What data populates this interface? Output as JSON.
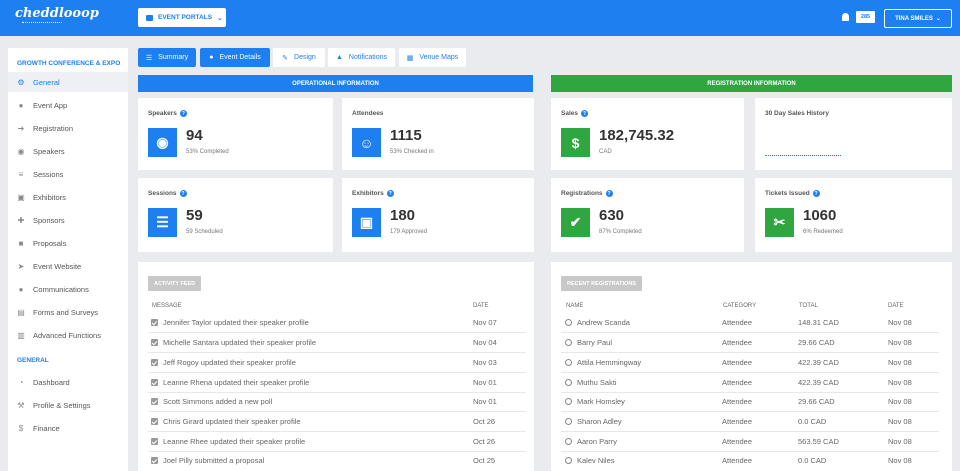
{
  "header": {
    "logo_text": "cheddlooop",
    "portals_label": "EVENT PORTALS",
    "notification_count": "285",
    "user_label": "TINA SMILES"
  },
  "sidebar": {
    "event_heading": "GROWTH CONFERENCE & EXPO",
    "event_items": [
      {
        "label": "General",
        "icon": "gear-icon"
      },
      {
        "label": "Event App",
        "icon": "apple-icon"
      },
      {
        "label": "Registration",
        "icon": "sign-in-icon"
      },
      {
        "label": "Speakers",
        "icon": "user-circle-icon"
      },
      {
        "label": "Sessions",
        "icon": "list-icon"
      },
      {
        "label": "Exhibitors",
        "icon": "id-card-icon"
      },
      {
        "label": "Sponsors",
        "icon": "gift-icon"
      },
      {
        "label": "Proposals",
        "icon": "file-icon"
      },
      {
        "label": "Event Website",
        "icon": "cursor-icon"
      },
      {
        "label": "Communications",
        "icon": "chat-icon"
      },
      {
        "label": "Forms and Surveys",
        "icon": "form-icon"
      },
      {
        "label": "Advanced Functions",
        "icon": "chart-icon"
      }
    ],
    "general_heading": "GENERAL",
    "general_items": [
      {
        "label": "Dashboard",
        "icon": "dashboard-icon"
      },
      {
        "label": "Profile & Settings",
        "icon": "wrench-icon"
      },
      {
        "label": "Finance",
        "icon": "dollar-icon"
      }
    ]
  },
  "tabs": [
    "Summary",
    "Event Details",
    "Design",
    "Notifications",
    "Venue Maps"
  ],
  "sections": {
    "operational": "OPERATIONAL INFORMATION",
    "registration": "REGISTRATION INFORMATION"
  },
  "stats": {
    "speakers": {
      "title": "Speakers",
      "value": "94",
      "sub": "53% Completed"
    },
    "attendees": {
      "title": "Attendees",
      "value": "1115",
      "sub": "53% Checked in"
    },
    "sales": {
      "title": "Sales",
      "value": "182,745.32",
      "sub": "CAD"
    },
    "sales_history": {
      "title": "30 Day Sales History"
    },
    "sessions": {
      "title": "Sessions",
      "value": "59",
      "sub": "59 Scheduled"
    },
    "exhibitors": {
      "title": "Exhibitors",
      "value": "180",
      "sub": "179 Approved"
    },
    "registrations": {
      "title": "Registrations",
      "value": "630",
      "sub": "87% Completed"
    },
    "tickets": {
      "title": "Tickets Issued",
      "value": "1060",
      "sub": "6% Redeemed"
    }
  },
  "activity_feed": {
    "badge": "ACTIVITY FEED",
    "col_message": "MESSAGE",
    "col_date": "DATE",
    "rows": [
      {
        "message": "Jennifer Taylor updated their speaker profile",
        "date": "Nov 07"
      },
      {
        "message": "Michelle Santara updated their speaker profile",
        "date": "Nov 04"
      },
      {
        "message": "Jeff Rogoy updated their speaker profile",
        "date": "Nov 03"
      },
      {
        "message": "Leanne Rhena updated their speaker profile",
        "date": "Nov 01"
      },
      {
        "message": "Scott Simmons added a new poll",
        "date": "Nov 01"
      },
      {
        "message": "Chris Girard updated their speaker profile",
        "date": "Oct 26"
      },
      {
        "message": "Leanne Rhee updated their speaker profile",
        "date": "Oct 26"
      },
      {
        "message": "Joel Pilly submitted a proposal",
        "date": "Oct 25"
      }
    ]
  },
  "recent_registrations": {
    "badge": "RECENT REGISTRATIONS",
    "col_name": "NAME",
    "col_category": "CATEGORY",
    "col_total": "TOTAL",
    "col_date": "DATE",
    "rows": [
      {
        "name": "Andrew Scanda",
        "category": "Attendee",
        "total": "148.31 CAD",
        "date": "Nov 08"
      },
      {
        "name": "Barry Paul",
        "category": "Attendee",
        "total": "29.66 CAD",
        "date": "Nov 08"
      },
      {
        "name": "Attila Hemmingway",
        "category": "Attendee",
        "total": "422.39 CAD",
        "date": "Nov 08"
      },
      {
        "name": "Muthu Sakti",
        "category": "Attendee",
        "total": "422.39 CAD",
        "date": "Nov 08"
      },
      {
        "name": "Mark Homsley",
        "category": "Attendee",
        "total": "29.66 CAD",
        "date": "Nov 08"
      },
      {
        "name": "Sharon Adley",
        "category": "Attendee",
        "total": "0.0 CAD",
        "date": "Nov 08"
      },
      {
        "name": "Aaron Parry",
        "category": "Attendee",
        "total": "563.59 CAD",
        "date": "Nov 08"
      },
      {
        "name": "Kalev Niles",
        "category": "Attendee",
        "total": "0.0 CAD",
        "date": "Nov 08"
      }
    ]
  },
  "colors": {
    "primary": "#1e7ff0",
    "success": "#2fa640"
  }
}
